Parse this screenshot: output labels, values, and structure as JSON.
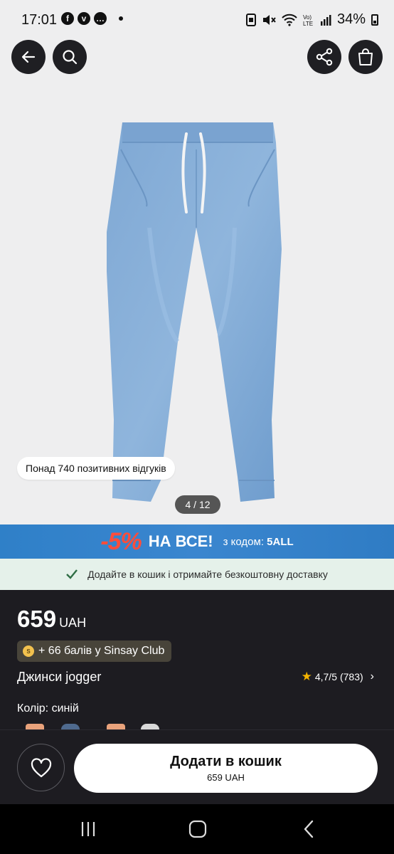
{
  "status": {
    "time": "17:01",
    "battery": "34%",
    "icons": [
      "facebook-icon",
      "viber-icon",
      "chat-icon",
      "dot",
      "screenshot-icon",
      "mute-icon",
      "wifi-icon",
      "volte-icon",
      "signal-icon",
      "battery-icon"
    ]
  },
  "hero": {
    "reviews_pill": "Понад 740 позитивних відгуків",
    "pager": "4 / 12",
    "current_image": 4,
    "total_images": 12,
    "buttons": [
      "back-icon",
      "search-icon",
      "share-icon",
      "bag-icon"
    ]
  },
  "promo": {
    "percent": "-5%",
    "headline": "НА ВСЕ!",
    "code_prefix": "з кодом:",
    "code": "5ALL"
  },
  "delivery": {
    "text": "Додайте в кошик і отримайте безкоштовну доставку"
  },
  "product": {
    "price": "659",
    "currency": "UAH",
    "club_badge": "+ 66 балів у Sinsay Club",
    "name": "Джинси jogger",
    "rating": "4,7/5",
    "reviews_count": "(783)",
    "color_label": "Колір:",
    "color_value": "синій"
  },
  "action": {
    "add_label": "Додати в кошик",
    "add_price": "659 UAH"
  },
  "colors": {
    "accent_blue": "#3a86cf",
    "promo_red": "#ff4d3a",
    "dark_bg": "#1d1c21",
    "delivery_bg": "#e5f1ea",
    "star": "#f4b400"
  }
}
